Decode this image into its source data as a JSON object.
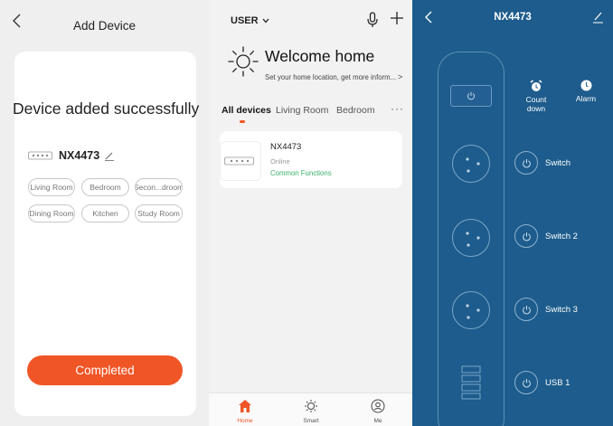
{
  "add_device": {
    "title": "Add Device",
    "success_text": "Device added successfully",
    "device_name": "NX4473",
    "rooms": [
      "Living Room",
      "Bedroom",
      "Secon...droom",
      "Dining Room",
      "Kitchen",
      "Study Room"
    ],
    "completed_label": "Completed"
  },
  "home": {
    "user_label": "USER",
    "welcome_title": "Welcome home",
    "location_prompt": "Set your home location, get more inform...",
    "tabs": [
      "All devices",
      "Living Room",
      "Bedroom"
    ],
    "more_label": "···",
    "device": {
      "name": "NX4473",
      "status": "Online",
      "functions_link": "Common Functions"
    },
    "nav": [
      {
        "label": "Home",
        "icon": "home-icon"
      },
      {
        "label": "Smart",
        "icon": "smart-icon"
      },
      {
        "label": "Me",
        "icon": "me-icon"
      }
    ]
  },
  "control": {
    "title": "NX4473",
    "countdown_label": "Count\ndown",
    "alarm_label": "Alarm",
    "switches": [
      "Switch",
      "Switch 2",
      "Switch 3",
      "USB 1"
    ]
  },
  "colors": {
    "accent": "#f05526",
    "online_green": "#3cae6a",
    "control_bg": "#1d5c8c"
  }
}
